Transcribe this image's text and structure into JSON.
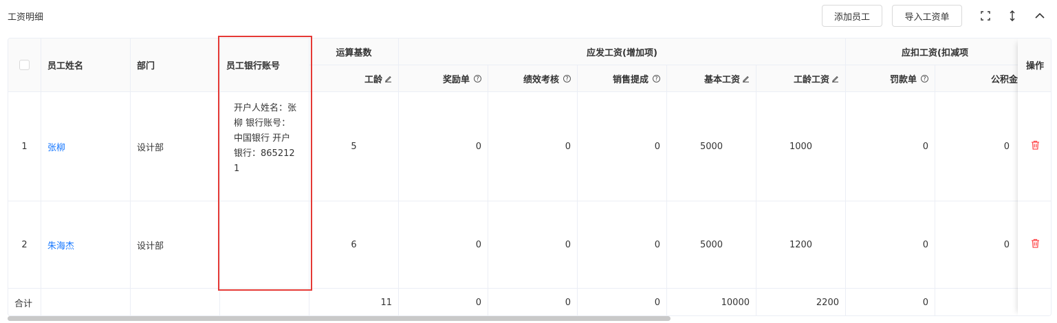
{
  "page": {
    "title": "工资明细",
    "buttons": {
      "add_employee": "添加员工",
      "import_payroll": "导入工资单"
    },
    "icons": [
      "fullscreen-icon",
      "row-height-icon",
      "collapse-up-icon"
    ]
  },
  "table": {
    "headers": {
      "name": "员工姓名",
      "dept": "部门",
      "bank": "员工银行账号",
      "base_group": "运算基数",
      "gross_group": "应发工资(增加项)",
      "deduct_group": "应扣工资(扣减项",
      "action": "操作",
      "seniority": "工龄",
      "bonus": "奖励单",
      "performance": "绩效考核",
      "sales_commission": "销售提成",
      "base_salary": "基本工资",
      "seniority_pay": "工龄工资",
      "penalty": "罚款单",
      "housing_fund": "公积金"
    },
    "rows": [
      {
        "index": "1",
        "name": "张柳",
        "dept": "设计部",
        "bank": "开户人姓名：张柳 银行账号：中国银行 开户银行：8652121",
        "seniority": "5",
        "bonus": "0",
        "performance": "0",
        "sales_commission": "0",
        "base_salary": "5000",
        "seniority_pay": "1000",
        "penalty": "0",
        "housing_fund": "0"
      },
      {
        "index": "2",
        "name": "朱海杰",
        "dept": "设计部",
        "bank": "",
        "seniority": "6",
        "bonus": "0",
        "performance": "0",
        "sales_commission": "0",
        "base_salary": "5000",
        "seniority_pay": "1200",
        "penalty": "0",
        "housing_fund": "0"
      }
    ],
    "totals": {
      "label": "合计",
      "seniority": "11",
      "bonus": "0",
      "performance": "0",
      "sales_commission": "0",
      "base_salary": "10000",
      "seniority_pay": "2200",
      "penalty": "0"
    }
  },
  "colors": {
    "link": "#1677ff",
    "danger": "#ff4d4f",
    "highlight_box": "#e53935",
    "header_bg": "#fafafa"
  }
}
